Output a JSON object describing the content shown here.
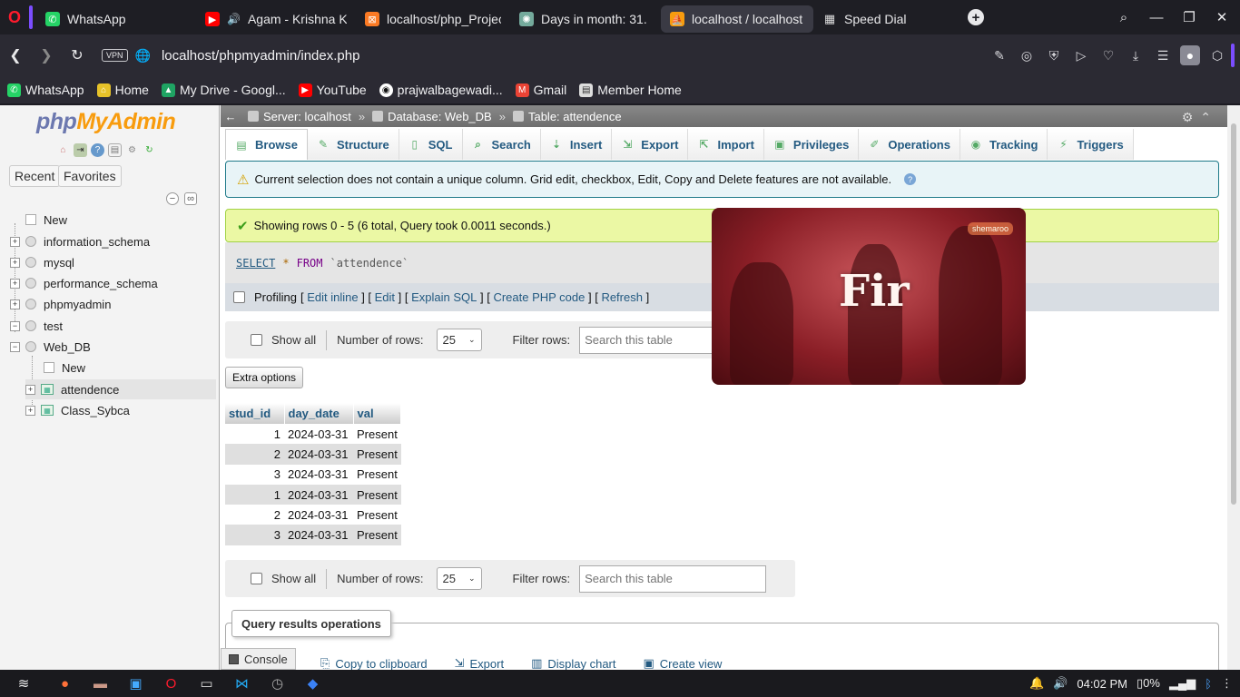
{
  "browser": {
    "tabs": [
      {
        "label": "WhatsApp",
        "icon": "whatsapp-icon",
        "color": "#25d366"
      },
      {
        "label": "Agam - Krishna Ki",
        "icon": "youtube-icon",
        "color": "#ff0000"
      },
      {
        "label": "localhost/php_Project",
        "icon": "xampp-icon",
        "color": "#fb7a24"
      },
      {
        "label": "Days in month: 31.",
        "icon": "chatgpt-icon",
        "color": "#74aa9c"
      },
      {
        "label": "localhost / localhost /",
        "icon": "phpmyadmin-icon",
        "color": "#f89c0e"
      },
      {
        "label": "Speed Dial",
        "icon": "speed-dial-icon",
        "color": "#cccccc"
      }
    ],
    "url": "localhost/phpmyadmin/index.php",
    "vpn_label": "VPN",
    "bookmarks": [
      {
        "label": "WhatsApp",
        "icon": "whatsapp-icon",
        "color": "#25d366"
      },
      {
        "label": "Home",
        "icon": "home-icon",
        "color": "#e6c229"
      },
      {
        "label": "My Drive - Googl...",
        "icon": "google-drive-icon",
        "color": "#1fa463"
      },
      {
        "label": "YouTube",
        "icon": "youtube-icon",
        "color": "#ff0000"
      },
      {
        "label": "prajwalbagewadi...",
        "icon": "github-icon",
        "color": "#ffffff"
      },
      {
        "label": "Gmail",
        "icon": "gmail-icon",
        "color": "#ea4335"
      },
      {
        "label": "Member Home",
        "icon": "document-icon",
        "color": "#dddddd"
      }
    ]
  },
  "pma": {
    "logo_php": "php",
    "logo_admin": "MyAdmin",
    "recent_label": "Recent",
    "favorites_label": "Favorites",
    "tree": [
      {
        "label": "New"
      },
      {
        "label": "information_schema"
      },
      {
        "label": "mysql"
      },
      {
        "label": "performance_schema"
      },
      {
        "label": "phpmyadmin"
      },
      {
        "label": "test"
      },
      {
        "label": "Web_DB"
      },
      {
        "label": "New"
      },
      {
        "label": "attendence"
      },
      {
        "label": "Class_Sybca"
      }
    ],
    "breadcrumb": {
      "server": "Server: localhost",
      "database": "Database: Web_DB",
      "table": "Table: attendence",
      "separator": "»"
    },
    "tabs": [
      "Browse",
      "Structure",
      "SQL",
      "Search",
      "Insert",
      "Export",
      "Import",
      "Privileges",
      "Operations",
      "Tracking",
      "Triggers"
    ],
    "notice": "Current selection does not contain a unique column. Grid edit, checkbox, Edit, Copy and Delete features are not available.",
    "success": "Showing rows 0 - 5 (6 total, Query took 0.0011 seconds.)",
    "sql": {
      "select": "SELECT",
      "star": "*",
      "from": "FROM",
      "table": "`attendence`"
    },
    "profiling": {
      "label": "Profiling",
      "links": [
        "Edit inline",
        "Edit",
        "Explain SQL",
        "Create PHP code",
        "Refresh"
      ]
    },
    "nav": {
      "show_all": "Show all",
      "num_rows_label": "Number of rows:",
      "num_rows_value": "25",
      "filter_label": "Filter rows:",
      "filter_placeholder": "Search this table"
    },
    "extra_options": "Extra options",
    "table": {
      "columns": [
        "stud_id",
        "day_date",
        "val"
      ],
      "rows": [
        [
          "1",
          "2024-03-31",
          "Present"
        ],
        [
          "2",
          "2024-03-31",
          "Present"
        ],
        [
          "3",
          "2024-03-31",
          "Present"
        ],
        [
          "1",
          "2024-03-31",
          "Present"
        ],
        [
          "2",
          "2024-03-31",
          "Present"
        ],
        [
          "3",
          "2024-03-31",
          "Present"
        ]
      ]
    },
    "query_results_ops": "Query results operations",
    "qro_links": [
      "Copy to clipboard",
      "Export",
      "Display chart",
      "Create view"
    ],
    "console": "Console"
  },
  "video_overlay": {
    "text": "Fir",
    "logo": "shemaroo"
  },
  "taskbar": {
    "time": "04:02 PM",
    "battery": "0%"
  }
}
